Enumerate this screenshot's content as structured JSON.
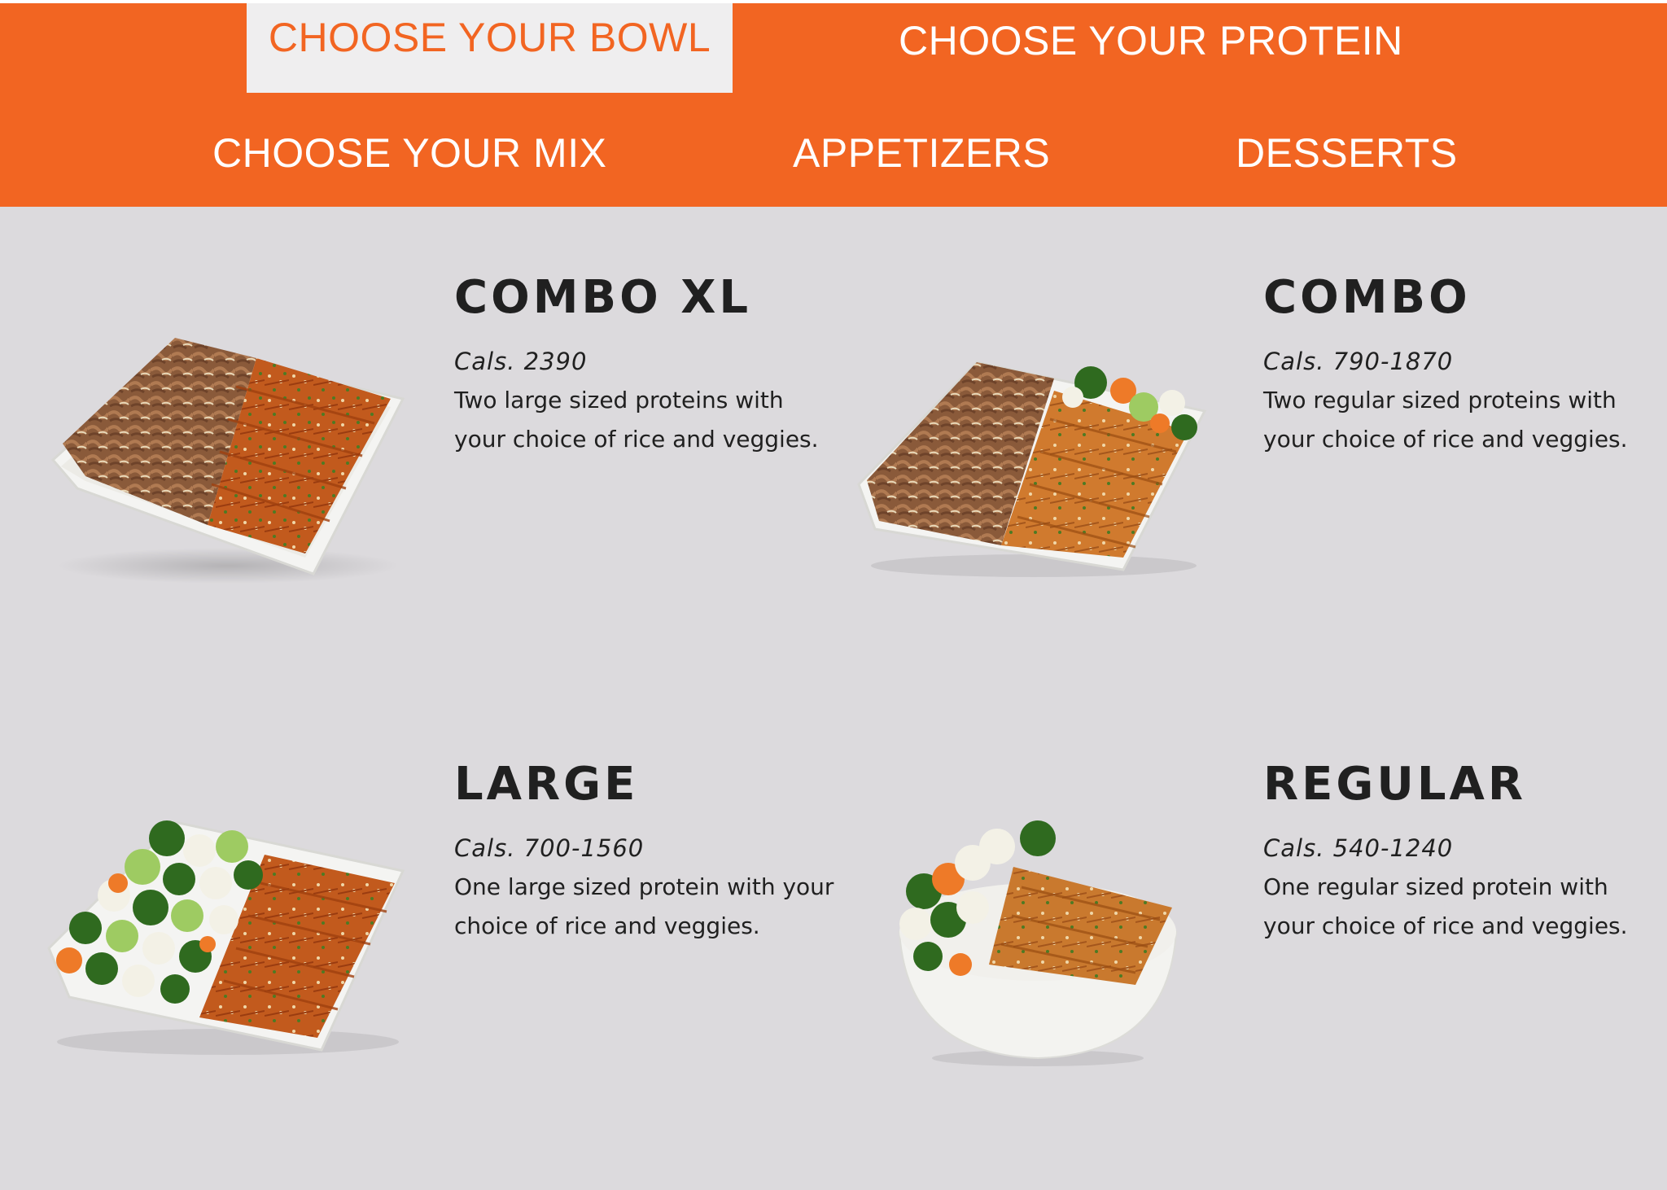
{
  "nav": {
    "tabs": [
      {
        "label": "CHOOSE YOUR BOWL",
        "active": true
      },
      {
        "label": "CHOOSE YOUR PROTEIN",
        "active": false
      },
      {
        "label": "CHOOSE YOUR MIX",
        "active": false
      },
      {
        "label": "APPETIZERS",
        "active": false
      },
      {
        "label": "DESSERTS",
        "active": false
      }
    ]
  },
  "bowls": [
    {
      "title": "COMBO XL",
      "cals": "Cals. 2390",
      "description": "Two large sized proteins with your choice of rice and veggies.",
      "image": "square-bowl-beef-chicken-icon"
    },
    {
      "title": "COMBO",
      "cals": "Cals. 790-1870",
      "description": "Two regular sized proteins with your choice of rice and veggies.",
      "image": "square-bowl-beef-chicken-veggies-icon"
    },
    {
      "title": "LARGE",
      "cals": "Cals. 700-1560",
      "description": "One large sized protein with your choice of rice and veggies.",
      "image": "square-bowl-veggies-chicken-icon"
    },
    {
      "title": "REGULAR",
      "cals": "Cals. 540-1240",
      "description": "One regular sized protein with your choice of rice and veggies.",
      "image": "round-bowl-chicken-veggies-icon"
    }
  ],
  "colors": {
    "nav_bg": "#f26522",
    "active_tab_bg": "#efeeef",
    "page_bg": "#dcdadd",
    "text": "#202020"
  }
}
